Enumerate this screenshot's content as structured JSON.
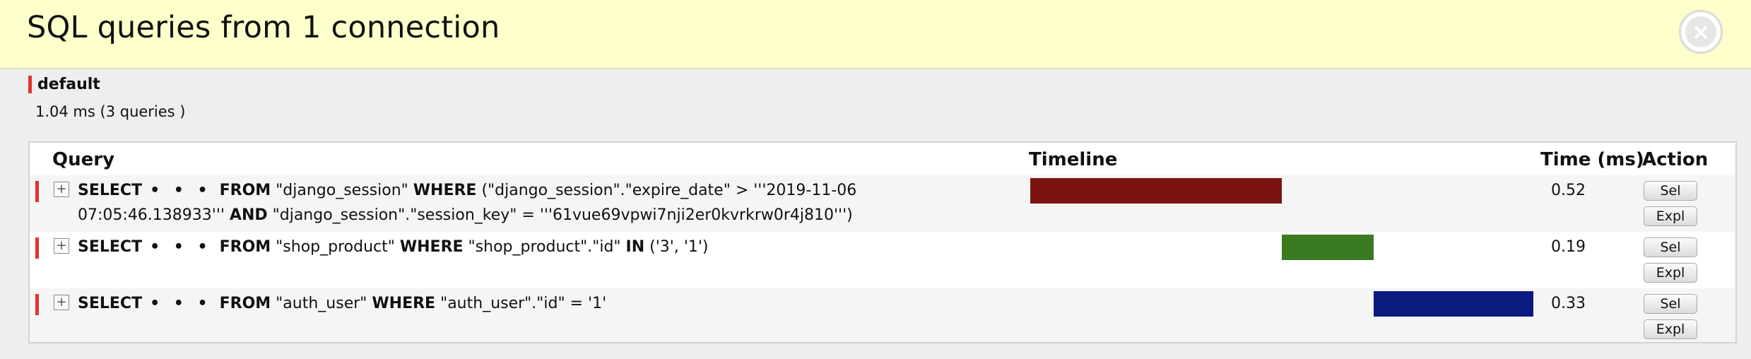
{
  "header": {
    "title": "SQL queries from 1 connection",
    "close_icon": "×"
  },
  "connection": {
    "alias": "default",
    "summary": "1.04 ms (3 queries )"
  },
  "columns": {
    "query": "Query",
    "timeline": "Timeline",
    "time": "Time (ms)",
    "action": "Action"
  },
  "colors": {
    "marker": "#e0342c",
    "bar1": "#7b1410",
    "bar2": "#3a7a21",
    "bar3": "#0b1a7e"
  },
  "queries": [
    {
      "toggle": "+",
      "kw_select": "SELECT",
      "dots": "• • •",
      "kw_from": "FROM",
      "table": "\"django_session\"",
      "kw_where": "WHERE",
      "cond1": "(\"django_session\".\"expire_date\" > '''2019-11-06 07:05:46.138933''' ",
      "kw_and": "AND",
      "cond2": "\"django_session\".\"session_key\" = '''61vue69vpwi7nji2er0kvrkrw0r4j810''')",
      "time": "0.52",
      "sel_label": "Sel",
      "expl_label": "Expl"
    },
    {
      "toggle": "+",
      "kw_select": "SELECT",
      "dots": "• • •",
      "kw_from": "FROM",
      "table": "\"shop_product\"",
      "kw_where": "WHERE",
      "cond1": "\"shop_product\".\"id\" ",
      "kw_in": "IN",
      "cond2": "('3', '1')",
      "time": "0.19",
      "sel_label": "Sel",
      "expl_label": "Expl"
    },
    {
      "toggle": "+",
      "kw_select": "SELECT",
      "dots": "• • •",
      "kw_from": "FROM",
      "table": "\"auth_user\"",
      "kw_where": "WHERE",
      "cond1": "\"auth_user\".\"id\" = '1'",
      "time": "0.33",
      "sel_label": "Sel",
      "expl_label": "Expl"
    }
  ]
}
